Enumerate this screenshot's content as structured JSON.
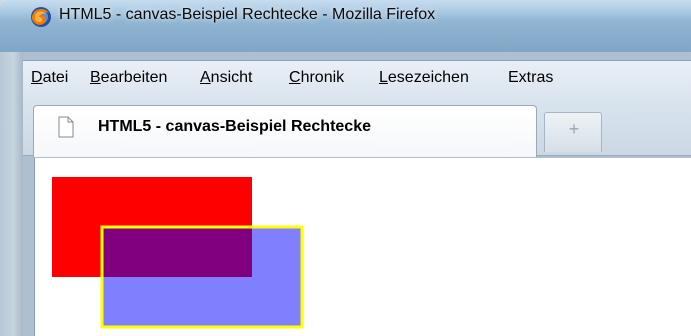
{
  "window": {
    "title": "HTML5 - canvas-Beispiel Rechtecke - Mozilla Firefox"
  },
  "menubar": {
    "items": [
      {
        "label": "Datei",
        "u": "D",
        "rest": "atei"
      },
      {
        "label": "Bearbeiten",
        "u": "B",
        "rest": "earbeiten"
      },
      {
        "label": "Ansicht",
        "u": "A",
        "rest": "nsicht"
      },
      {
        "label": "Chronik",
        "u": "C",
        "rest": "hronik"
      },
      {
        "label": "Lesezeichen",
        "u": "L",
        "rest": "esezeichen"
      },
      {
        "label": "Extras",
        "u": "",
        "rest": "Extras"
      }
    ]
  },
  "tabs": {
    "active_label": "HTML5 - canvas-Beispiel Rechtecke",
    "new_tab_glyph": "+"
  },
  "canvas": {
    "rect_red": {
      "fill": "#ff0000"
    },
    "rect_blue": {
      "fill": "#8080ff",
      "stroke": "#ffff00"
    },
    "overlap_color": "#800080"
  },
  "icons": {
    "browser": "firefox-icon",
    "tab_page": "page-icon",
    "new_tab": "plus-icon"
  }
}
